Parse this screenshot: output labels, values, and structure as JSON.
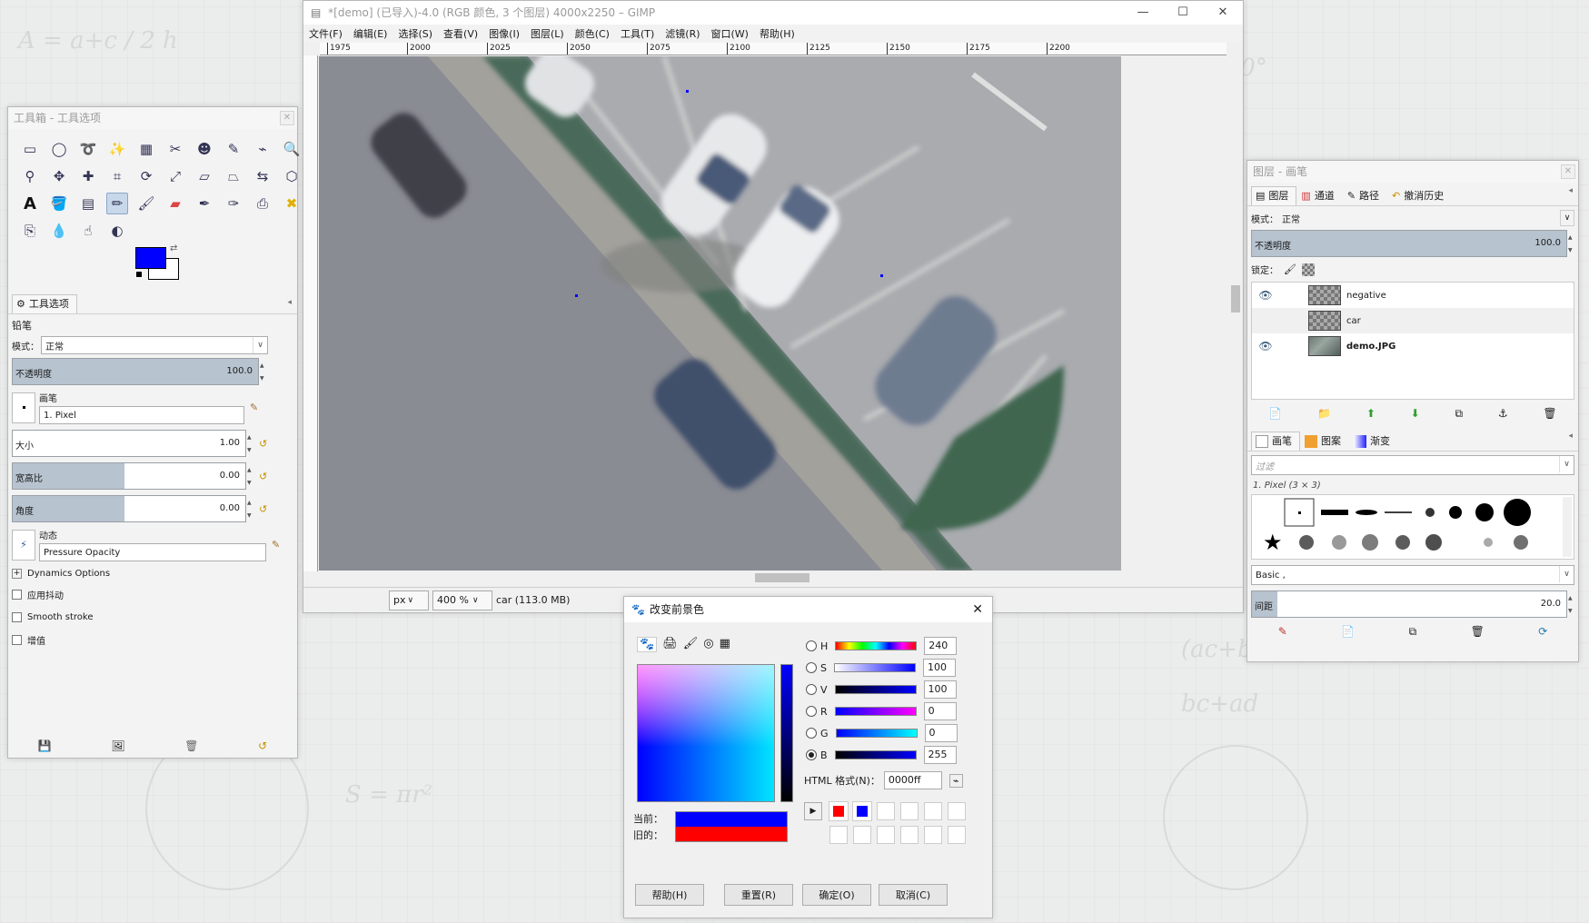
{
  "main_window": {
    "title": "*[demo] (已导入)-4.0 (RGB 颜色, 3 个图层) 4000x2250 – GIMP",
    "menu": [
      "文件(F)",
      "编辑(E)",
      "选择(S)",
      "查看(V)",
      "图像(I)",
      "图层(L)",
      "颜色(C)",
      "工具(T)",
      "滤镜(R)",
      "窗口(W)",
      "帮助(H)"
    ],
    "ruler_ticks": [
      "1975",
      "2000",
      "2025",
      "2050",
      "2075",
      "2100",
      "2125",
      "2150",
      "2175",
      "2200"
    ],
    "unit": "px",
    "zoom": "400 %",
    "status_text": "car (113.0 MB)"
  },
  "toolbox": {
    "title": "工具箱 - 工具选项",
    "fg_color": "#0000ff",
    "bg_color": "#ffffff",
    "options_tab": "工具选项",
    "tool_name": "铅笔",
    "mode_label": "模式：",
    "mode_value": "正常",
    "opacity_label": "不透明度",
    "opacity_value": "100.0",
    "brush_label": "画笔",
    "brush_value": "1. Pixel",
    "size_label": "大小",
    "size_value": "1.00",
    "aspect_label": "宽高比",
    "aspect_value": "0.00",
    "angle_label": "角度",
    "angle_value": "0.00",
    "dynamics_label": "动态",
    "dynamics_value": "Pressure Opacity",
    "dynamics_options": "Dynamics Options",
    "check_jitter": "应用抖动",
    "check_smooth": "Smooth stroke",
    "check_incremental": "增值"
  },
  "layers": {
    "title": "图层 - 画笔",
    "tabs": [
      "图层",
      "通道",
      "路径",
      "撤消历史"
    ],
    "mode_label": "模式：",
    "mode_value": "正常",
    "opacity_label": "不透明度",
    "opacity_value": "100.0",
    "lock_label": "锁定：",
    "items": [
      {
        "name": "negative",
        "visible": true
      },
      {
        "name": "car",
        "visible": false
      },
      {
        "name": "demo.JPG",
        "visible": true
      }
    ],
    "brush_tabs": [
      "画笔",
      "图案",
      "渐变"
    ],
    "filter_placeholder": "过滤",
    "brush_name": "1. Pixel (3 × 3)",
    "brush_tag": "Basic ,",
    "spacing_label": "间距",
    "spacing_value": "20.0"
  },
  "color_dialog": {
    "title": "改变前景色",
    "channels": [
      {
        "label": "H",
        "value": "240"
      },
      {
        "label": "S",
        "value": "100"
      },
      {
        "label": "V",
        "value": "100"
      },
      {
        "label": "R",
        "value": "0"
      },
      {
        "label": "G",
        "value": "0"
      },
      {
        "label": "B",
        "value": "255"
      }
    ],
    "html_label": "HTML 格式(N)：",
    "html_value": "0000ff",
    "current_label": "当前：",
    "old_label": "旧的：",
    "current_color": "#0000ff",
    "old_color": "#ff0000",
    "history_colors": [
      "#ff0000",
      "#0000ff"
    ],
    "buttons": [
      "帮助(H)",
      "重置(R)",
      "确定(O)",
      "取消(C)"
    ]
  }
}
